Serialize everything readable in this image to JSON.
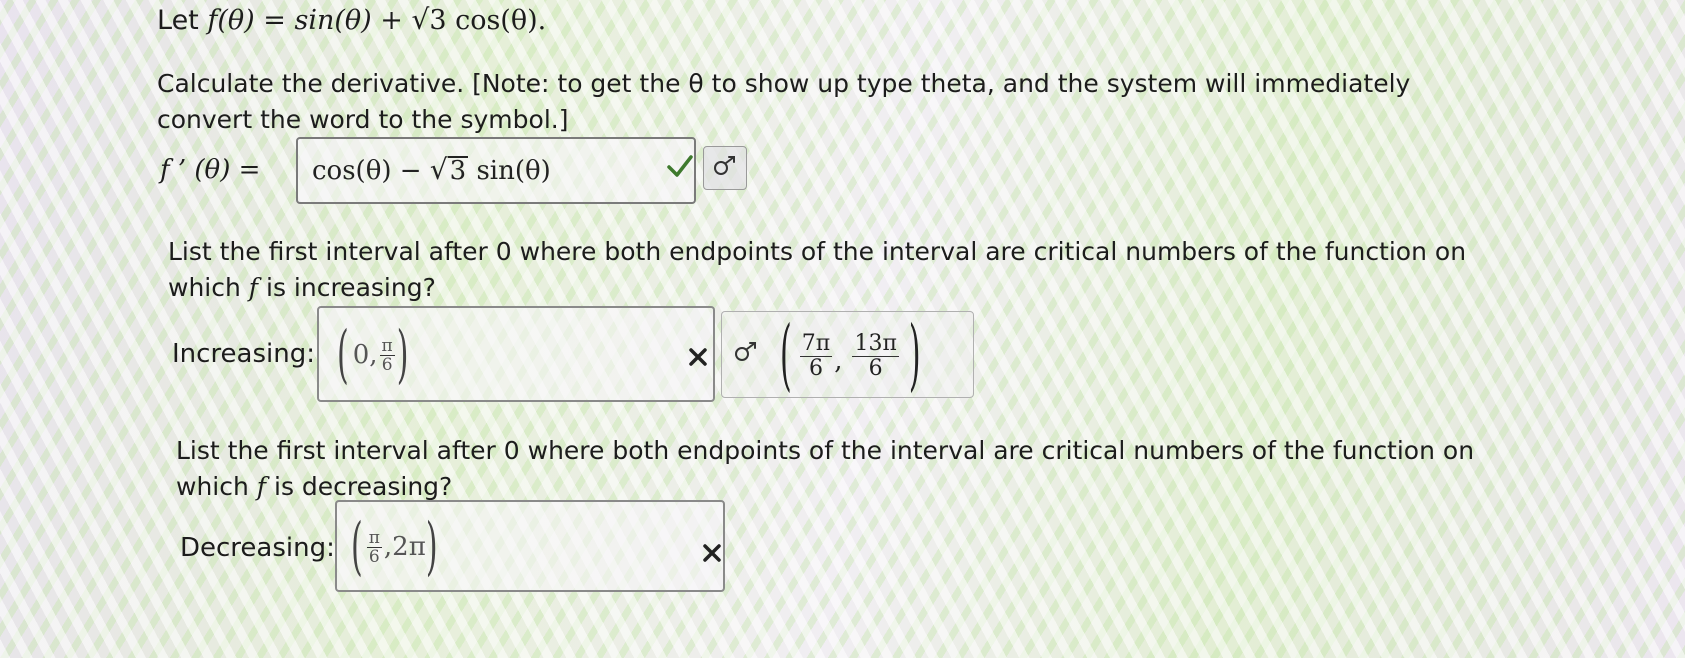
{
  "problem": {
    "let_prefix": "Let",
    "function_def": "f(θ) = sin(θ) + ",
    "function_def_tail": "3 cos(θ).",
    "derivative_prompt": "Calculate the derivative. [Note: to get the θ to show up type theta, and the system will immediately convert the word to the symbol.]",
    "derivative_label": "f ’ (θ) =",
    "increasing_prompt_before": "List the first interval after 0 where both endpoints of the interval are critical numbers of the function on which",
    "increasing_prompt_f": "f",
    "increasing_prompt_after": "is increasing?",
    "decreasing_prompt_before": "List the first interval after 0 where both endpoints of the interval are critical numbers of the function on which",
    "decreasing_prompt_f": "f",
    "decreasing_prompt_after": "is decreasing?"
  },
  "derivative_answer": {
    "expr_before": "cos(θ) − ",
    "sqrt_arg": "3",
    "expr_after": " sin(θ)",
    "status_icon": "check-icon",
    "status_color": "#3f7a2e"
  },
  "increasing": {
    "label": "Increasing:",
    "open_paren": "(",
    "start": "0,",
    "frac_num": "π",
    "frac_den": "6",
    "close_paren": ")",
    "status_icon": "cross-icon",
    "correct": {
      "open_paren": "(",
      "a_num": "7π",
      "a_den": "6",
      "comma": ",",
      "b_num": "13π",
      "b_den": "6",
      "close_paren": ")"
    }
  },
  "decreasing": {
    "label": "Decreasing:",
    "open_paren": "(",
    "frac_num": "π",
    "frac_den": "6",
    "end": ",2π",
    "close_paren": ")",
    "status_icon": "cross-icon"
  },
  "icons": {
    "answer_key": "sigma-key-icon"
  }
}
